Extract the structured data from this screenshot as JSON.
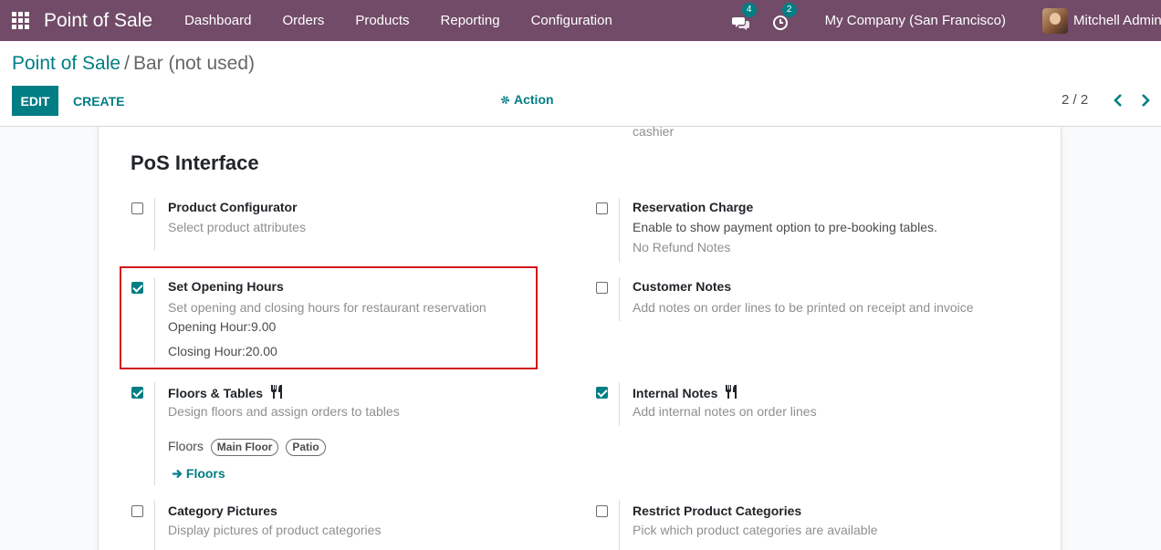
{
  "navbar": {
    "app_name": "Point of Sale",
    "menu": [
      "Dashboard",
      "Orders",
      "Products",
      "Reporting",
      "Configuration"
    ],
    "messages_count": "4",
    "activities_count": "2",
    "company": "My Company (San Francisco)",
    "user": "Mitchell Admin"
  },
  "breadcrumb": {
    "parent": "Point of Sale",
    "separator": "/",
    "current": "Bar (not used)"
  },
  "buttons": {
    "edit": "EDIT",
    "create": "CREATE",
    "action": "Action"
  },
  "pager": {
    "text": "2 / 2"
  },
  "sheet": {
    "partial_top_text": "cashier",
    "section_title": "PoS Interface",
    "settings": {
      "product_configurator": {
        "title": "Product Configurator",
        "desc": "Select product attributes",
        "checked": false
      },
      "reservation_charge": {
        "title": "Reservation Charge",
        "desc": "Enable to show payment option to pre-booking tables.",
        "extra": "No Refund Notes",
        "checked": false
      },
      "set_opening_hours": {
        "title": "Set Opening Hours",
        "desc": "Set opening and closing hours for restaurant reservation",
        "opening": "Opening Hour:9.00",
        "closing": "Closing Hour:20.00",
        "checked": true
      },
      "customer_notes": {
        "title": "Customer Notes",
        "desc": "Add notes on order lines to be printed on receipt and invoice",
        "checked": false
      },
      "floors_tables": {
        "title": "Floors & Tables",
        "desc": "Design floors and assign orders to tables",
        "floors_label": "Floors",
        "floor_tags": [
          "Main Floor",
          "Patio"
        ],
        "floors_link": "Floors",
        "checked": true
      },
      "internal_notes": {
        "title": "Internal Notes",
        "desc": "Add internal notes on order lines",
        "checked": true
      },
      "category_pictures": {
        "title": "Category Pictures",
        "desc": "Display pictures of product categories",
        "checked": false
      },
      "restrict_categories": {
        "title": "Restrict Product Categories",
        "desc": "Pick which product categories are available",
        "checked": false
      }
    }
  },
  "colors": {
    "navbar": "#714b67",
    "accent": "#017e84",
    "highlight": "#d1141b"
  }
}
